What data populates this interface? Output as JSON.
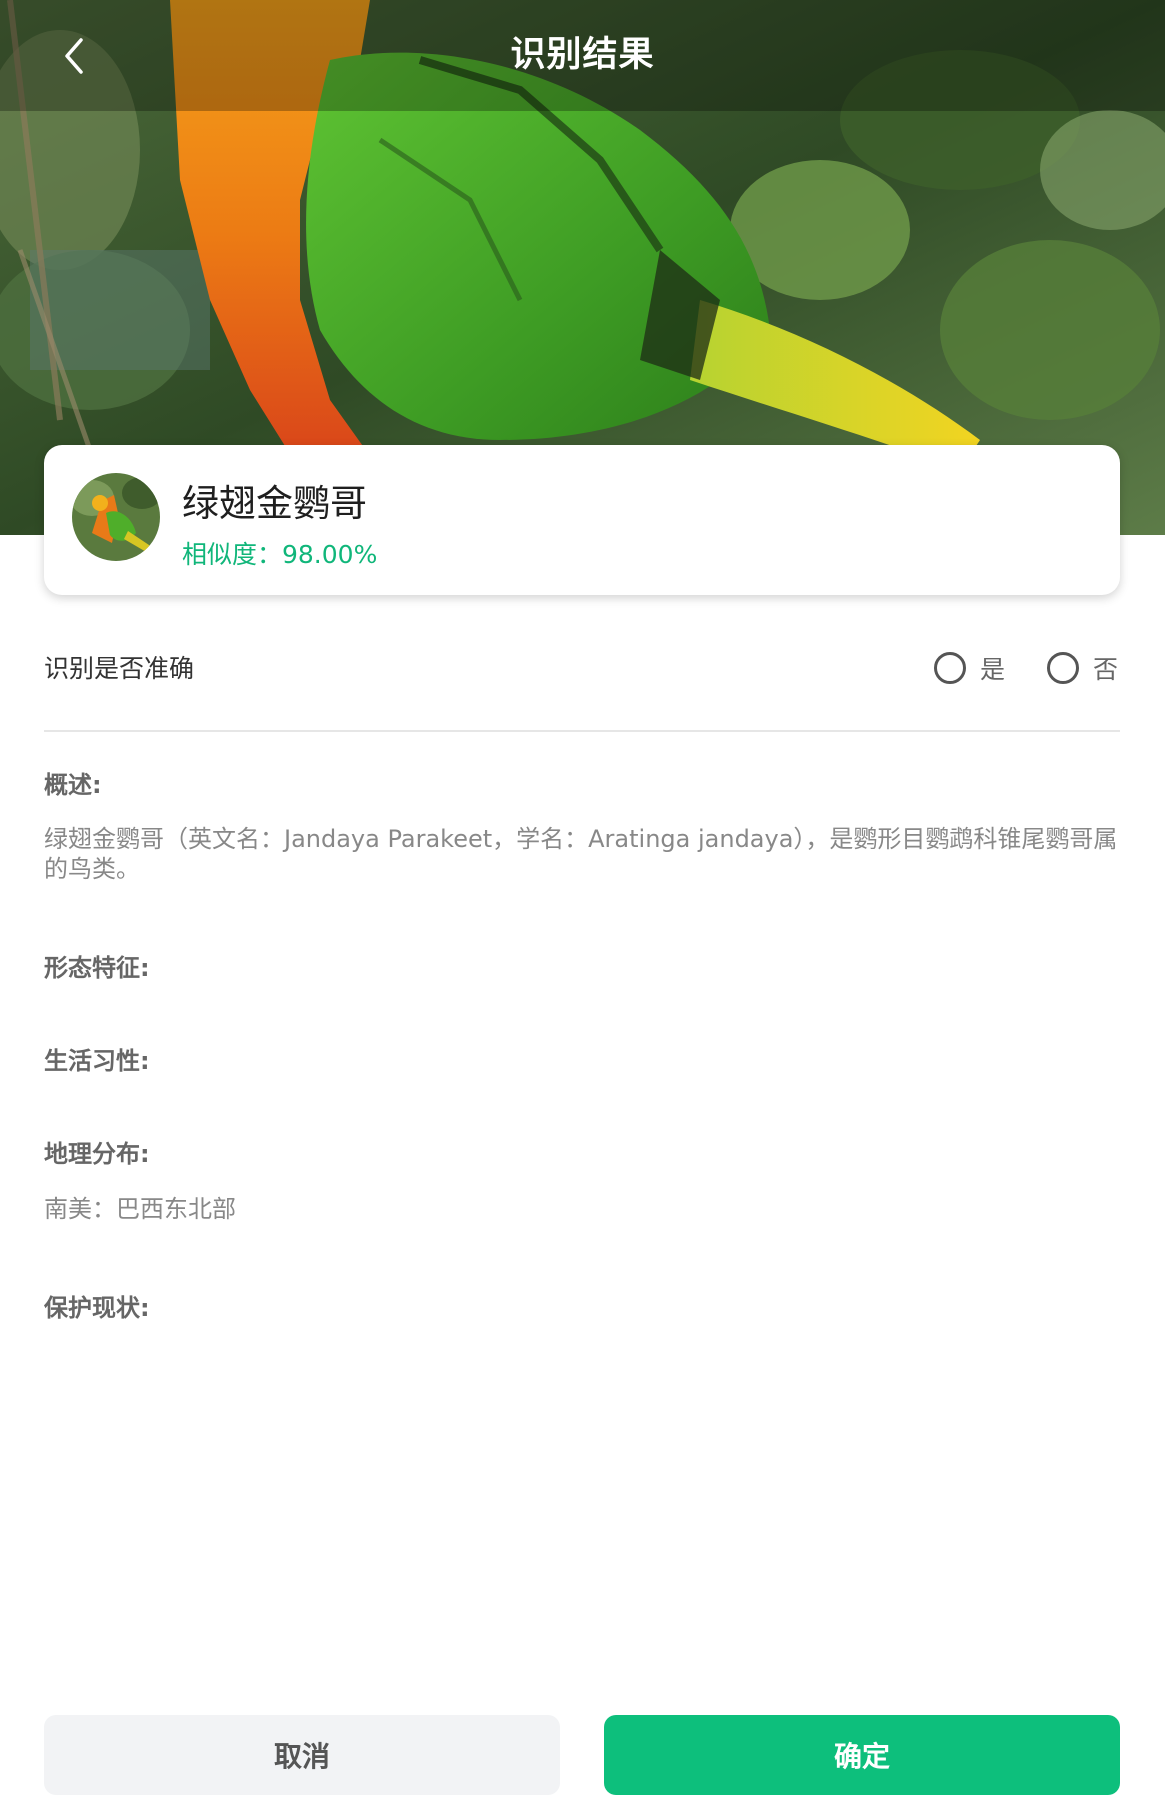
{
  "header": {
    "title": "识别结果",
    "back_icon": "chevron-left-icon"
  },
  "result": {
    "name": "绿翅金鹦哥",
    "similarity": "相似度：98.00%",
    "similarity_value": 0.98,
    "accent_color": "#10b67a"
  },
  "accuracy": {
    "label": "识别是否准确",
    "options": [
      {
        "label": "是",
        "selected": false
      },
      {
        "label": "否",
        "selected": false
      }
    ]
  },
  "sections": [
    {
      "heading": "概述:",
      "body": "绿翅金鹦哥（英文名：Jandaya Parakeet，学名：Aratinga jandaya），是鹦形目鹦鹉科锥尾鹦哥属的鸟类。"
    },
    {
      "heading": "形态特征:",
      "body": ""
    },
    {
      "heading": "生活习性:",
      "body": ""
    },
    {
      "heading": "地理分布:",
      "body": "南美：巴西东北部"
    },
    {
      "heading": "保护现状:",
      "body": ""
    }
  ],
  "buttons": {
    "cancel": "取消",
    "confirm": "确定",
    "confirm_color": "#0dbf7c"
  }
}
